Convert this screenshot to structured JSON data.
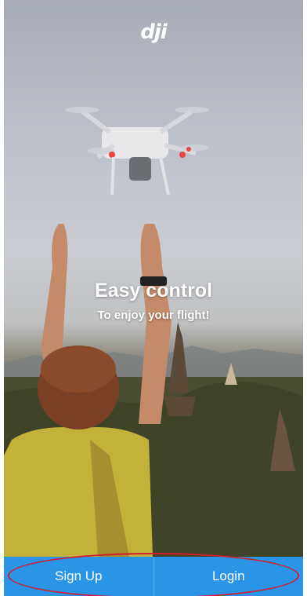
{
  "brand": {
    "logo_text": "dji"
  },
  "hero": {
    "headline": "Easy control",
    "subline": "To enjoy your flight!"
  },
  "bottom_bar": {
    "sign_up_label": "Sign Up",
    "login_label": "Login"
  },
  "colors": {
    "bottom_bar_background": "#2a94e6",
    "button_text": "#ffffff",
    "highlight_oval": "#d21e2b"
  }
}
